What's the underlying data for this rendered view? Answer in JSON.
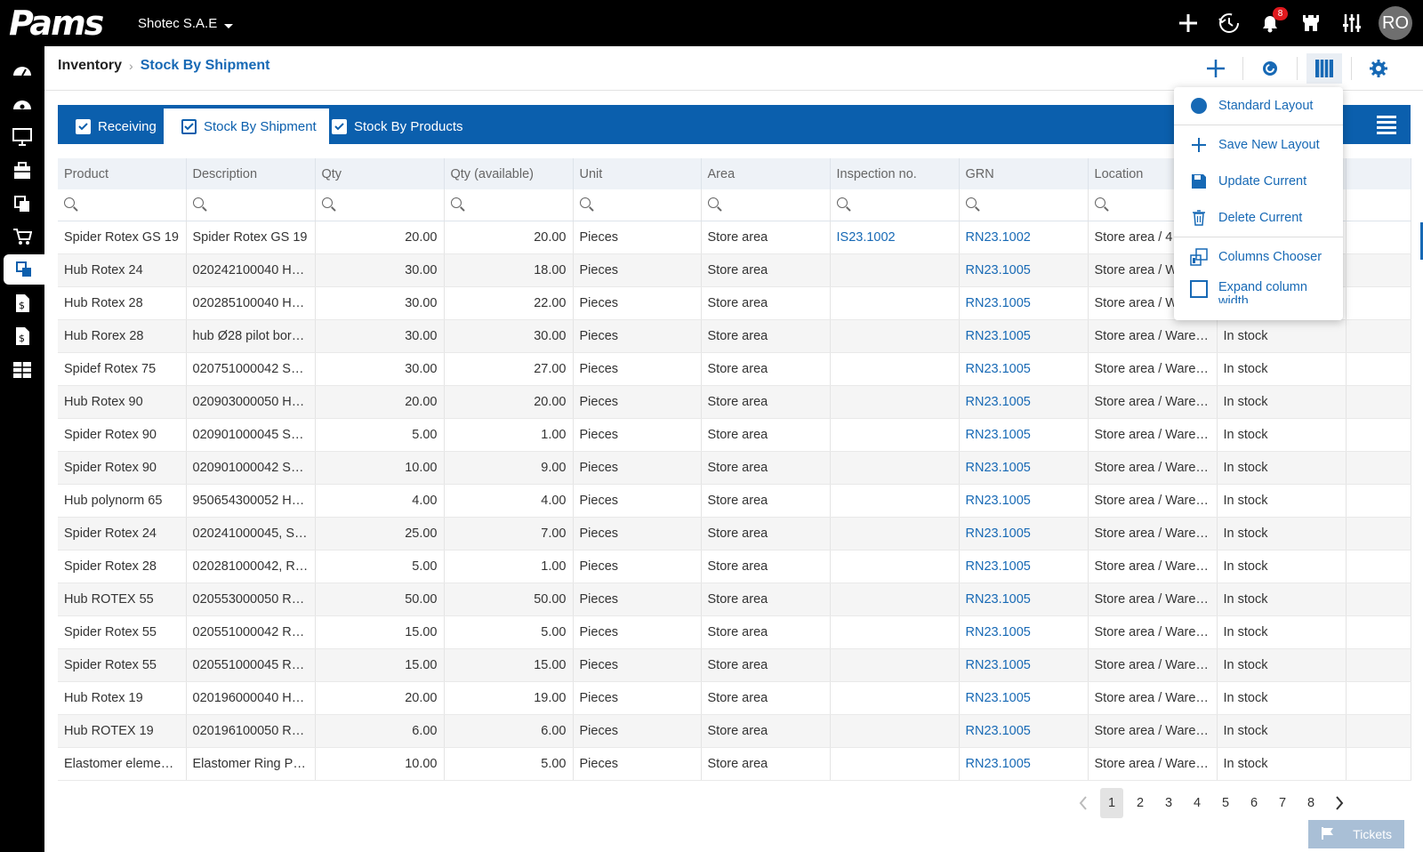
{
  "app": {
    "logo": "Pams",
    "company": "Shotec S.A.E"
  },
  "topbar": {
    "icons": [
      "plus-icon",
      "history-icon",
      "bell-icon",
      "castle-icon",
      "sliders-icon"
    ],
    "notifications": "8",
    "avatar": "RO"
  },
  "sidebar": {
    "items": [
      "dashboard-icon",
      "dashboard-alt-icon",
      "monitor-icon",
      "briefcase-icon",
      "documents-icon",
      "cart-icon",
      "inventory-icon",
      "invoice-icon",
      "invoice-alt-icon",
      "reports-icon"
    ],
    "active_index": 6
  },
  "breadcrumb": {
    "root": "Inventory",
    "current": "Stock By Shipment"
  },
  "tabs": [
    {
      "label": "Receiving",
      "active": false
    },
    {
      "label": "Stock By Shipment",
      "active": true
    },
    {
      "label": "Stock By Products",
      "active": false
    }
  ],
  "dropdown": {
    "items": [
      "Standard Layout",
      "Save New Layout",
      "Update Current",
      "Delete Current",
      "Columns Chooser",
      "Expand column width"
    ]
  },
  "table": {
    "columns": [
      "Product",
      "Description",
      "Qty",
      "Qty (available)",
      "Unit",
      "Area",
      "Inspection no.",
      "GRN",
      "Location",
      "",
      ""
    ],
    "rows": [
      [
        "Spider Rotex GS 19",
        "Spider Rotex GS 19",
        "20.00",
        "20.00",
        "Pieces",
        "Store area",
        "IS23.1002",
        "RN23.1002",
        "Store area / 4",
        "",
        ""
      ],
      [
        "Hub Rotex 24",
        "020242100040 Hu…",
        "30.00",
        "18.00",
        "Pieces",
        "Store area",
        "",
        "RN23.1005",
        "Store area / W",
        "",
        ""
      ],
      [
        "Hub Rotex 28",
        "020285100040 Hu…",
        "30.00",
        "22.00",
        "Pieces",
        "Store area",
        "",
        "RN23.1005",
        "Store area / W",
        "",
        ""
      ],
      [
        "Hub Rorex 28",
        "hub Ø28 pilot bor…",
        "30.00",
        "30.00",
        "Pieces",
        "Store area",
        "",
        "RN23.1005",
        "Store area / Ware…",
        "In stock",
        ""
      ],
      [
        "Spidef Rotex 75",
        "020751000042 SP…",
        "30.00",
        "27.00",
        "Pieces",
        "Store area",
        "",
        "RN23.1005",
        "Store area / Ware…",
        "In stock",
        ""
      ],
      [
        "Hub Rotex 90",
        "020903000050 Hu…",
        "20.00",
        "20.00",
        "Pieces",
        "Store area",
        "",
        "RN23.1005",
        "Store area / Ware…",
        "In stock",
        ""
      ],
      [
        "Spider Rotex 90",
        "020901000045 SP…",
        "5.00",
        "1.00",
        "Pieces",
        "Store area",
        "",
        "RN23.1005",
        "Store area / Ware…",
        "In stock",
        ""
      ],
      [
        "Spider Rotex 90",
        "020901000042 SP…",
        "10.00",
        "9.00",
        "Pieces",
        "Store area",
        "",
        "RN23.1005",
        "Store area / Ware…",
        "In stock",
        ""
      ],
      [
        "Hub polynorm 65",
        "950654300052 H…",
        "4.00",
        "4.00",
        "Pieces",
        "Store area",
        "",
        "RN23.1005",
        "Store area / Ware…",
        "In stock",
        ""
      ],
      [
        "Spider Rotex 24",
        "020241000045, S…",
        "25.00",
        "7.00",
        "Pieces",
        "Store area",
        "",
        "RN23.1005",
        "Store area / Ware…",
        "In stock",
        ""
      ],
      [
        "Spider Rotex 28",
        "020281000042, R…",
        "5.00",
        "1.00",
        "Pieces",
        "Store area",
        "",
        "RN23.1005",
        "Store area / Ware…",
        "In stock",
        ""
      ],
      [
        "Hub ROTEX 55",
        "020553000050 R…",
        "50.00",
        "50.00",
        "Pieces",
        "Store area",
        "",
        "RN23.1005",
        "Store area / Ware…",
        "In stock",
        ""
      ],
      [
        "Spider Rotex 55",
        "020551000042 R…",
        "15.00",
        "5.00",
        "Pieces",
        "Store area",
        "",
        "RN23.1005",
        "Store area / Ware…",
        "In stock",
        ""
      ],
      [
        "Spider Rotex 55",
        "020551000045 R…",
        "15.00",
        "15.00",
        "Pieces",
        "Store area",
        "",
        "RN23.1005",
        "Store area / Ware…",
        "In stock",
        ""
      ],
      [
        "Hub Rotex 19",
        "020196000040 Hu…",
        "20.00",
        "19.00",
        "Pieces",
        "Store area",
        "",
        "RN23.1005",
        "Store area / Ware…",
        "In stock",
        ""
      ],
      [
        "Hub ROTEX 19",
        "020196100050 R…",
        "6.00",
        "6.00",
        "Pieces",
        "Store area",
        "",
        "RN23.1005",
        "Store area / Ware…",
        "In stock",
        ""
      ],
      [
        "Elastomer eleme…",
        "Elastomer Ring P…",
        "10.00",
        "5.00",
        "Pieces",
        "Store area",
        "",
        "RN23.1005",
        "Store area / Ware…",
        "In stock",
        ""
      ]
    ]
  },
  "pager": {
    "pages": [
      "1",
      "2",
      "3",
      "4",
      "5",
      "6",
      "7",
      "8"
    ],
    "current": "1"
  },
  "tickets": "Tickets",
  "colors": {
    "accent": "#0b5fad",
    "link": "#1769b5",
    "topbar": "#000000"
  }
}
